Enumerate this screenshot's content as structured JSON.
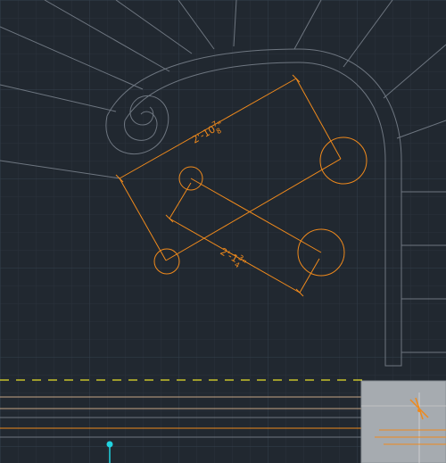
{
  "app": {
    "type": "CAD drawing viewport",
    "background_color": "#212830",
    "grid_minor_color": "#2a323c",
    "grid_major_color": "#34404c"
  },
  "colors": {
    "geometry": "#6e7680",
    "selected_dimension": "#f08a1c",
    "dashed_line": "#e8e02a",
    "cursor": "#21d3e0",
    "stair_lines": "#c8a686",
    "preview_panel": "#a6abb0",
    "orange_accent": "#f08a1c"
  },
  "dimensions": {
    "top_label_prefix": "2'-10",
    "top_fraction_num": "7",
    "top_fraction_den": "8",
    "top_label_suffix": "\"",
    "bottom_label_prefix": "2'-1",
    "bottom_fraction_num": "3",
    "bottom_fraction_den": "4",
    "bottom_label_suffix": "\""
  },
  "icons": {
    "cursor": "crosshair-cursor-icon",
    "grip": "grip-marker-icon"
  }
}
